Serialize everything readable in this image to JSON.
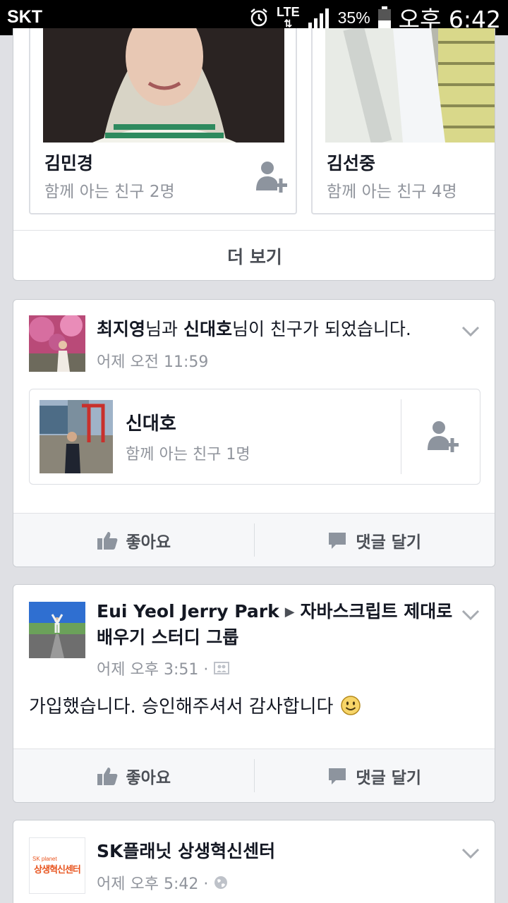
{
  "status_bar": {
    "carrier": "SKT",
    "network": "LTE",
    "battery": "35%",
    "time": "오후 6:42"
  },
  "suggestions": {
    "people": [
      {
        "name": "김민경",
        "mutual": "함께 아는 친구 2명"
      },
      {
        "name": "김선중",
        "mutual": "함께 아는 친구 4명"
      }
    ],
    "more_label": "더 보기"
  },
  "friendship_story": {
    "actor1": "최지영",
    "joiner1": "님과 ",
    "actor2": "신대호",
    "joiner2": "님이 친구가 되었습니다.",
    "time": "어제 오전 11:59",
    "friend": {
      "name": "신대호",
      "mutual": "함께 아는 친구 1명"
    },
    "like_label": "좋아요",
    "comment_label": "댓글 달기"
  },
  "group_post": {
    "author": "Eui Yeol Jerry Park",
    "group": "자바스크립트 제대로 배우기 스터디 그룹",
    "time": "어제 오후 3:51 ·",
    "body": "가입했습니다. 승인해주셔서 감사합니다",
    "like_label": "좋아요",
    "comment_label": "댓글 달기"
  },
  "page_post": {
    "author": "SK플래닛 상생혁신센터",
    "logo_small": "SK planet",
    "logo_text": "상생혁신센터",
    "time": "어제 오후 5:42 ·"
  },
  "colors": {
    "accent": "#3b5998",
    "muted": "#90949c",
    "icon": "#8d949e"
  }
}
